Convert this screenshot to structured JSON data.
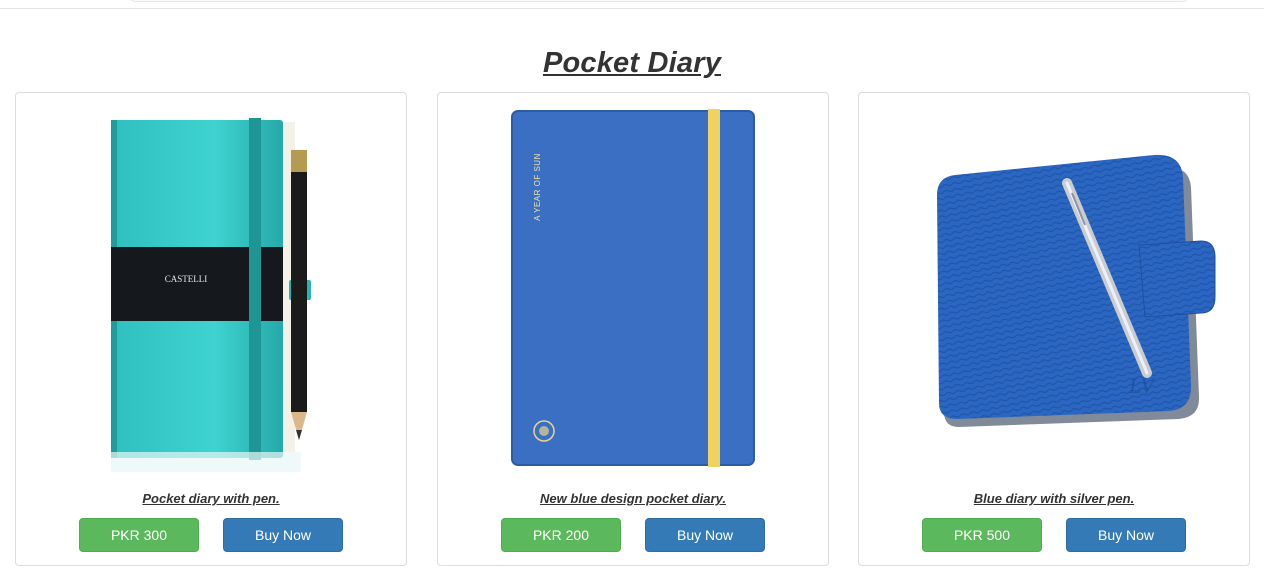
{
  "page": {
    "title": "Pocket Diary"
  },
  "colors": {
    "price_button": "#5cb85c",
    "buy_button": "#337ab7"
  },
  "products": [
    {
      "caption": "Pocket diary with pen.",
      "price_label": "PKR 300",
      "buy_label": "Buy Now",
      "brand_text": "CASTELLI",
      "image": "teal-notebook-with-pencil"
    },
    {
      "caption": "New blue design pocket diary.",
      "price_label": "PKR 200",
      "buy_label": "Buy Now",
      "cover_text": "A YEAR OF SUN",
      "image": "blue-notebook-yellow-band"
    },
    {
      "caption": "Blue diary with silver pen.",
      "price_label": "PKR 500",
      "buy_label": "Buy Now",
      "image": "blue-leather-diary-silver-pen"
    }
  ]
}
